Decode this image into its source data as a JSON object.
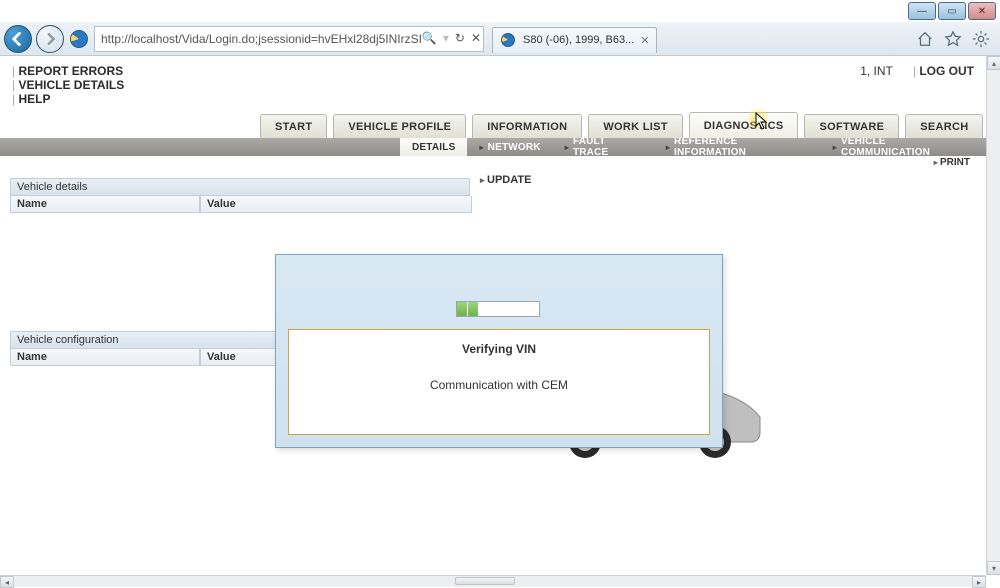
{
  "window": {
    "minimize": "—",
    "maximize": "▭",
    "close": "✕"
  },
  "browser": {
    "url": "http://localhost/Vida/Login.do;jsessionid=hvEHxl28dj5INIrzSI",
    "search_icon": "🔍",
    "tab_title": "S80 (-06), 1999, B63..."
  },
  "header": {
    "links": [
      "REPORT ERRORS",
      "VEHICLE DETAILS",
      "HELP"
    ],
    "user": "1, INT",
    "logout": "LOG OUT"
  },
  "tabs": {
    "primary": [
      "START",
      "VEHICLE PROFILE",
      "INFORMATION",
      "WORK LIST",
      "DIAGNOSTICS",
      "SOFTWARE",
      "SEARCH"
    ],
    "active_primary": "DIAGNOSTICS",
    "sub": [
      "DETAILS",
      "NETWORK",
      "FAULT TRACE",
      "REFERENCE INFORMATION",
      "VEHICLE COMMUNICATION"
    ],
    "active_sub": "DETAILS"
  },
  "actions": {
    "print": "PRINT",
    "update": "UPDATE"
  },
  "panels": {
    "vehicle_details": {
      "title": "Vehicle details",
      "name_col": "Name",
      "value_col": "Value"
    },
    "vehicle_config": {
      "title": "Vehicle configuration",
      "name_col": "Name",
      "value_col": "Value"
    }
  },
  "modal": {
    "title": "Verifying VIN",
    "message": "Communication with CEM"
  }
}
